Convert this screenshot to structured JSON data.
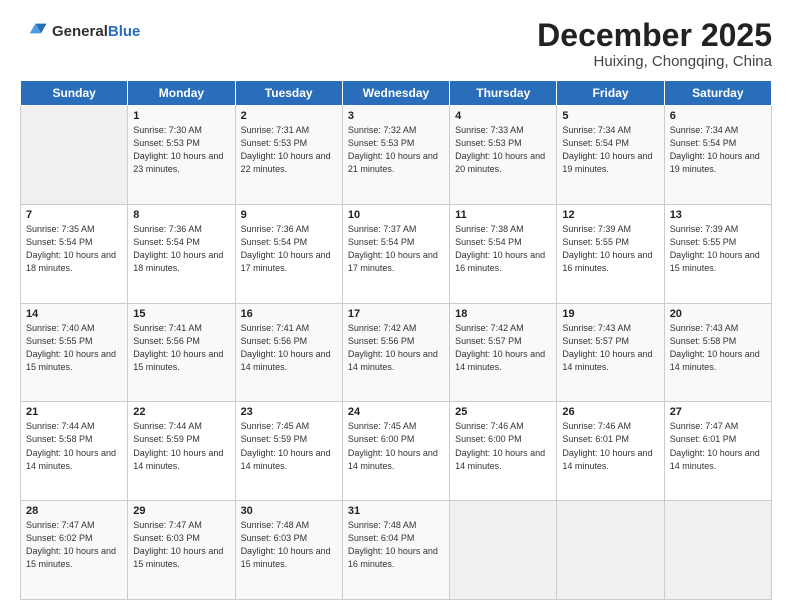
{
  "header": {
    "logo_general": "General",
    "logo_blue": "Blue",
    "title": "December 2025",
    "subtitle": "Huixing, Chongqing, China"
  },
  "weekdays": [
    "Sunday",
    "Monday",
    "Tuesday",
    "Wednesday",
    "Thursday",
    "Friday",
    "Saturday"
  ],
  "weeks": [
    [
      {
        "day": "",
        "info": ""
      },
      {
        "day": "1",
        "info": "Sunrise: 7:30 AM\nSunset: 5:53 PM\nDaylight: 10 hours\nand 23 minutes."
      },
      {
        "day": "2",
        "info": "Sunrise: 7:31 AM\nSunset: 5:53 PM\nDaylight: 10 hours\nand 22 minutes."
      },
      {
        "day": "3",
        "info": "Sunrise: 7:32 AM\nSunset: 5:53 PM\nDaylight: 10 hours\nand 21 minutes."
      },
      {
        "day": "4",
        "info": "Sunrise: 7:33 AM\nSunset: 5:53 PM\nDaylight: 10 hours\nand 20 minutes."
      },
      {
        "day": "5",
        "info": "Sunrise: 7:34 AM\nSunset: 5:54 PM\nDaylight: 10 hours\nand 19 minutes."
      },
      {
        "day": "6",
        "info": "Sunrise: 7:34 AM\nSunset: 5:54 PM\nDaylight: 10 hours\nand 19 minutes."
      }
    ],
    [
      {
        "day": "7",
        "info": "Sunrise: 7:35 AM\nSunset: 5:54 PM\nDaylight: 10 hours\nand 18 minutes."
      },
      {
        "day": "8",
        "info": "Sunrise: 7:36 AM\nSunset: 5:54 PM\nDaylight: 10 hours\nand 18 minutes."
      },
      {
        "day": "9",
        "info": "Sunrise: 7:36 AM\nSunset: 5:54 PM\nDaylight: 10 hours\nand 17 minutes."
      },
      {
        "day": "10",
        "info": "Sunrise: 7:37 AM\nSunset: 5:54 PM\nDaylight: 10 hours\nand 17 minutes."
      },
      {
        "day": "11",
        "info": "Sunrise: 7:38 AM\nSunset: 5:54 PM\nDaylight: 10 hours\nand 16 minutes."
      },
      {
        "day": "12",
        "info": "Sunrise: 7:39 AM\nSunset: 5:55 PM\nDaylight: 10 hours\nand 16 minutes."
      },
      {
        "day": "13",
        "info": "Sunrise: 7:39 AM\nSunset: 5:55 PM\nDaylight: 10 hours\nand 15 minutes."
      }
    ],
    [
      {
        "day": "14",
        "info": "Sunrise: 7:40 AM\nSunset: 5:55 PM\nDaylight: 10 hours\nand 15 minutes."
      },
      {
        "day": "15",
        "info": "Sunrise: 7:41 AM\nSunset: 5:56 PM\nDaylight: 10 hours\nand 15 minutes."
      },
      {
        "day": "16",
        "info": "Sunrise: 7:41 AM\nSunset: 5:56 PM\nDaylight: 10 hours\nand 14 minutes."
      },
      {
        "day": "17",
        "info": "Sunrise: 7:42 AM\nSunset: 5:56 PM\nDaylight: 10 hours\nand 14 minutes."
      },
      {
        "day": "18",
        "info": "Sunrise: 7:42 AM\nSunset: 5:57 PM\nDaylight: 10 hours\nand 14 minutes."
      },
      {
        "day": "19",
        "info": "Sunrise: 7:43 AM\nSunset: 5:57 PM\nDaylight: 10 hours\nand 14 minutes."
      },
      {
        "day": "20",
        "info": "Sunrise: 7:43 AM\nSunset: 5:58 PM\nDaylight: 10 hours\nand 14 minutes."
      }
    ],
    [
      {
        "day": "21",
        "info": "Sunrise: 7:44 AM\nSunset: 5:58 PM\nDaylight: 10 hours\nand 14 minutes."
      },
      {
        "day": "22",
        "info": "Sunrise: 7:44 AM\nSunset: 5:59 PM\nDaylight: 10 hours\nand 14 minutes."
      },
      {
        "day": "23",
        "info": "Sunrise: 7:45 AM\nSunset: 5:59 PM\nDaylight: 10 hours\nand 14 minutes."
      },
      {
        "day": "24",
        "info": "Sunrise: 7:45 AM\nSunset: 6:00 PM\nDaylight: 10 hours\nand 14 minutes."
      },
      {
        "day": "25",
        "info": "Sunrise: 7:46 AM\nSunset: 6:00 PM\nDaylight: 10 hours\nand 14 minutes."
      },
      {
        "day": "26",
        "info": "Sunrise: 7:46 AM\nSunset: 6:01 PM\nDaylight: 10 hours\nand 14 minutes."
      },
      {
        "day": "27",
        "info": "Sunrise: 7:47 AM\nSunset: 6:01 PM\nDaylight: 10 hours\nand 14 minutes."
      }
    ],
    [
      {
        "day": "28",
        "info": "Sunrise: 7:47 AM\nSunset: 6:02 PM\nDaylight: 10 hours\nand 15 minutes."
      },
      {
        "day": "29",
        "info": "Sunrise: 7:47 AM\nSunset: 6:03 PM\nDaylight: 10 hours\nand 15 minutes."
      },
      {
        "day": "30",
        "info": "Sunrise: 7:48 AM\nSunset: 6:03 PM\nDaylight: 10 hours\nand 15 minutes."
      },
      {
        "day": "31",
        "info": "Sunrise: 7:48 AM\nSunset: 6:04 PM\nDaylight: 10 hours\nand 16 minutes."
      },
      {
        "day": "",
        "info": ""
      },
      {
        "day": "",
        "info": ""
      },
      {
        "day": "",
        "info": ""
      }
    ]
  ]
}
